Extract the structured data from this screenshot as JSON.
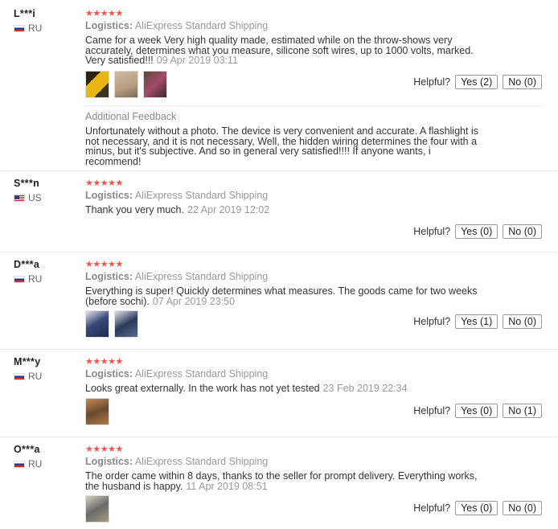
{
  "stars_text": "★★★★★",
  "helpful_label": "Helpful?",
  "logistics_label": "Logistics:",
  "reviews": [
    {
      "user": "L***i",
      "country": "RU",
      "logistics": "AliExpress Standard Shipping",
      "text": "Came for a week Very high quality made, estimated while on the throw-shows very accurately, determines what you measure, silicone soft wires, up to 1000 volts, marked. Very satisfied!!!",
      "date": "09 Apr 2019 03:11",
      "yes": "Yes (2)",
      "no": "No (0)",
      "additional_title": "Additional Feedback",
      "additional_text": "Unfortunately without a photo. The device is very convenient and accurate. A flashlight is not necessary, and it is not necessary, Well, the hidden wiring determines the four with a minus, but it's subjective. And so in general very satisfied!!!! If anyone wants, i recommend!"
    },
    {
      "user": "S***n",
      "country": "US",
      "logistics": "AliExpress Standard Shipping",
      "text": "Thank you very much.",
      "date": "22 Apr 2019 12:02",
      "yes": "Yes (0)",
      "no": "No (0)"
    },
    {
      "user": "D***a",
      "country": "RU",
      "logistics": "AliExpress Standard Shipping",
      "text": "Everything is super! Quickly determines what measures. The goods came for two weeks (before sochi).",
      "date": "07 Apr 2019 23:50",
      "yes": "Yes (1)",
      "no": "No (0)"
    },
    {
      "user": "M***y",
      "country": "RU",
      "logistics": "AliExpress Standard Shipping",
      "text": "Looks great externally. In the work has not yet tested",
      "date": "23 Feb 2019 22:34",
      "yes": "Yes (0)",
      "no": "No (1)"
    },
    {
      "user": "O***a",
      "country": "RU",
      "logistics": "AliExpress Standard Shipping",
      "text": "The order came within 8 days, thanks to the seller for prompt delivery. Everything works, the husband is happy.",
      "date": "11 Apr 2019 08:51",
      "yes": "Yes (0)",
      "no": "No (0)"
    }
  ],
  "colors": {
    "stars": "#f5544c",
    "meta_gray": "#999999",
    "separator": "#e8e8e8"
  }
}
